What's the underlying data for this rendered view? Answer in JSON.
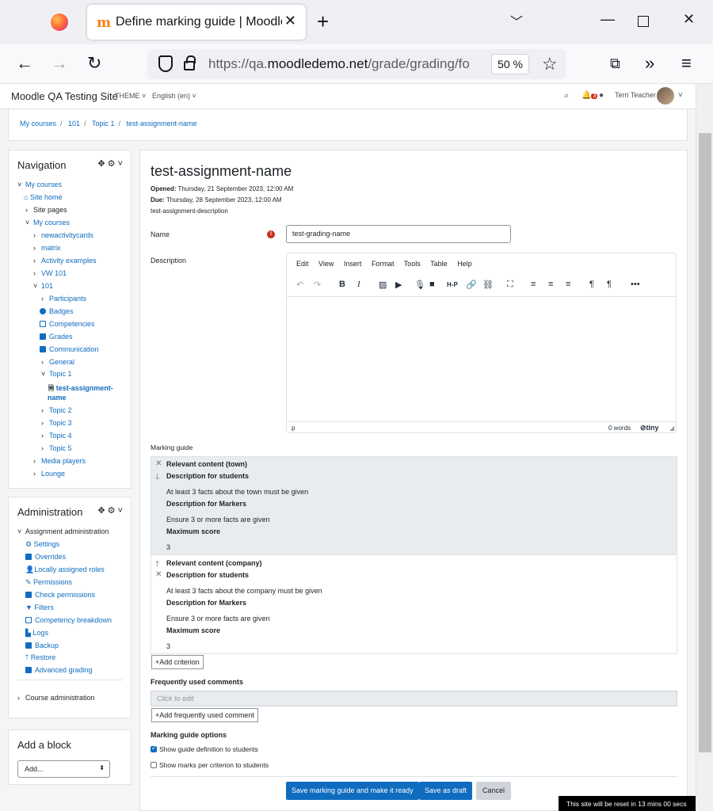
{
  "browser": {
    "tab_title": "Define marking guide | Moodle",
    "new_tab": "+",
    "url_prefix": "https://qa.",
    "url_domain": "moodledemo.net",
    "url_path": "/grade/grading/fo",
    "zoom": "50 %"
  },
  "header": {
    "site_name": "Moodle QA Testing Site",
    "theme_menu": "THEME",
    "language_menu": "English (en)",
    "notification_count": "3",
    "user_name": "Terri Teacher"
  },
  "breadcrumb": [
    "My courses",
    "101",
    "Topic 1",
    "test-assignment-name"
  ],
  "navigation": {
    "title": "Navigation",
    "items": [
      {
        "label": "My courses",
        "icon": "chevron-down"
      },
      {
        "label": "Site home",
        "icon": "home"
      },
      {
        "label": "Site pages",
        "icon": "chevron-right"
      },
      {
        "label": "My courses",
        "icon": "chevron-down"
      },
      {
        "label": "newactivitycards",
        "icon": "chevron-right"
      },
      {
        "label": "matrix",
        "icon": "chevron-right"
      },
      {
        "label": "Activity examples",
        "icon": "chevron-right"
      },
      {
        "label": "VW 101",
        "icon": "chevron-right"
      },
      {
        "label": "101",
        "icon": "chevron-down"
      },
      {
        "label": "Participants",
        "icon": "chevron-right"
      },
      {
        "label": "Badges",
        "icon": "badge"
      },
      {
        "label": "Competencies",
        "icon": "checkbox"
      },
      {
        "label": "Grades",
        "icon": "table"
      },
      {
        "label": "Communication",
        "icon": "square"
      },
      {
        "label": "General",
        "icon": "chevron-right"
      },
      {
        "label": "Topic 1",
        "icon": "chevron-down"
      },
      {
        "label": "test-assignment-",
        "icon": "file"
      },
      {
        "label": "name",
        "icon": ""
      },
      {
        "label": "Topic 2",
        "icon": "chevron-right"
      },
      {
        "label": "Topic 3",
        "icon": "chevron-right"
      },
      {
        "label": "Topic 4",
        "icon": "chevron-right"
      },
      {
        "label": "Topic 5",
        "icon": "chevron-right"
      },
      {
        "label": "Media players",
        "icon": "chevron-right"
      },
      {
        "label": "Lounge",
        "icon": "chevron-right"
      }
    ]
  },
  "administration": {
    "title": "Administration",
    "items": [
      {
        "label": "Assignment administration",
        "icon": "chevron-down"
      },
      {
        "label": "Settings",
        "icon": "gear"
      },
      {
        "label": "Overrides",
        "icon": "square"
      },
      {
        "label": "Locally assigned roles",
        "icon": "user"
      },
      {
        "label": "Permissions",
        "icon": "edit"
      },
      {
        "label": "Check permissions",
        "icon": "square"
      },
      {
        "label": "Filters",
        "icon": "filter"
      },
      {
        "label": "Competency breakdown",
        "icon": "checkbox"
      },
      {
        "label": "Logs",
        "icon": "chart"
      },
      {
        "label": "Backup",
        "icon": "square"
      },
      {
        "label": "Restore",
        "icon": "upload"
      },
      {
        "label": "Advanced grading",
        "icon": "square"
      },
      {
        "label": "Course administration",
        "icon": "chevron-right"
      }
    ]
  },
  "add_block": {
    "title": "Add a block",
    "select_value": "Add..."
  },
  "main": {
    "heading": "test-assignment-name",
    "opened_label": "Opened:",
    "opened_value": "Thursday, 21 September 2023, 12:00 AM",
    "due_label": "Due:",
    "due_value": "Thursday, 28 September 2023, 12:00 AM",
    "description_text": "test-assignment-description",
    "name_label": "Name",
    "name_value": "test-grading-name",
    "description_label": "Description",
    "editor_menu": [
      "Edit",
      "View",
      "Insert",
      "Format",
      "Tools",
      "Table",
      "Help"
    ],
    "editor_status_path": "p",
    "editor_word_count": "0 words",
    "editor_brand": "tiny",
    "marking_guide_label": "Marking guide",
    "criteria": [
      {
        "name": "Relevant content (town)",
        "desc_students_label": "Description for students",
        "desc_students": "At least 3 facts about the town must be given",
        "desc_markers_label": "Description for Markers",
        "desc_markers": "Ensure 3 or more facts are given",
        "max_score_label": "Maximum score",
        "max_score": "3"
      },
      {
        "name": "Relevant content (company)",
        "desc_students_label": "Description for students",
        "desc_students": "At least 3 facts about the company must be given",
        "desc_markers_label": "Description for Markers",
        "desc_markers": "Ensure 3 or more facts are given",
        "max_score_label": "Maximum score",
        "max_score": "3"
      }
    ],
    "add_criterion": "Add criterion",
    "frequent_comments_label": "Frequently used comments",
    "click_to_edit": "Click to edit",
    "add_comment": "Add frequently used comment",
    "options_label": "Marking guide options",
    "option_show_definition": "Show guide definition to students",
    "option_show_marks": "Show marks per criterion to students",
    "save_ready": "Save marking guide and make it ready",
    "save_draft": "Save as draft",
    "cancel": "Cancel"
  },
  "reset_notice": "This site will be reset in 13 mins 00 secs",
  "colors": {
    "primary": "#0f6cbf",
    "danger": "#ca3120"
  }
}
